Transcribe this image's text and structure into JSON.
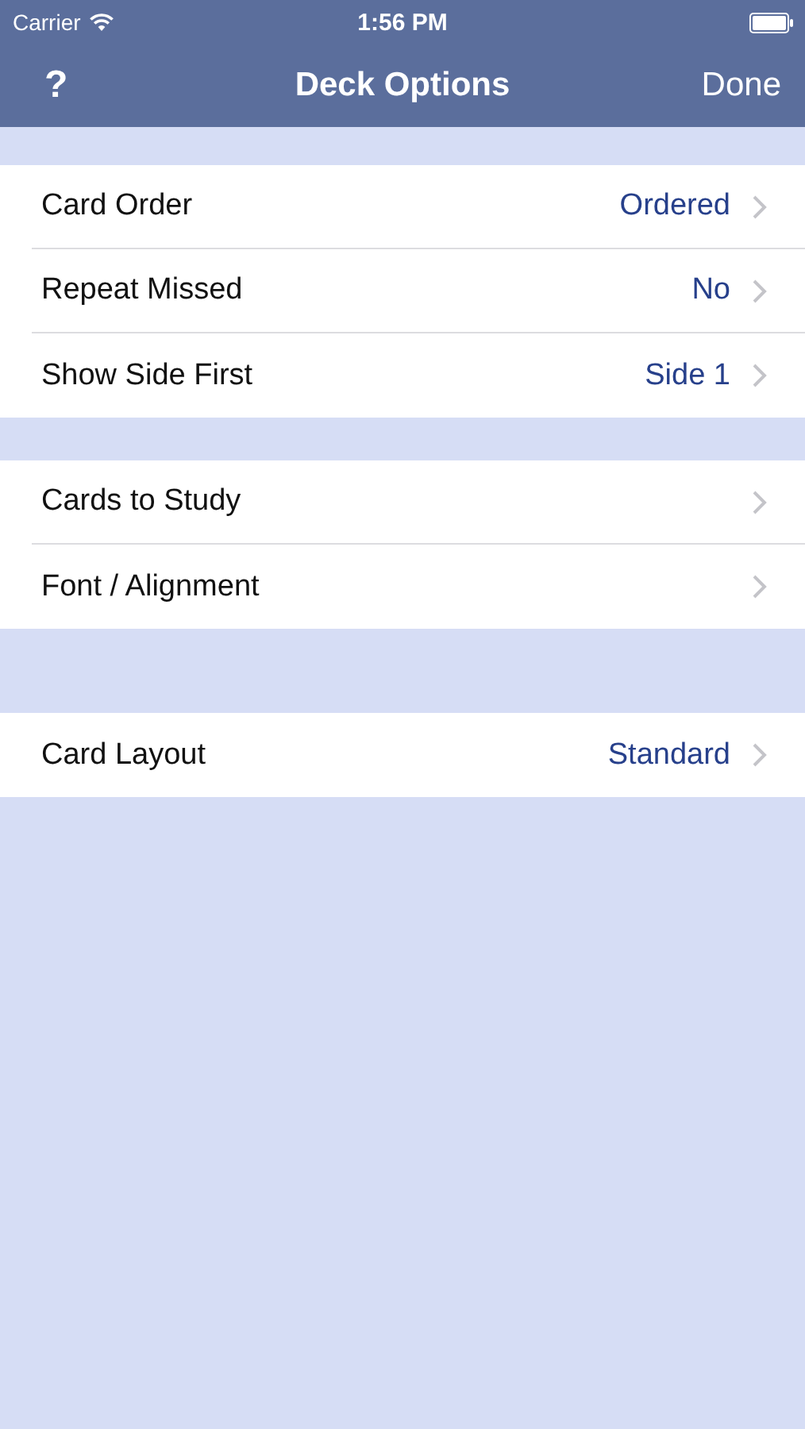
{
  "status_bar": {
    "carrier": "Carrier",
    "time": "1:56 PM"
  },
  "nav_bar": {
    "left": "?",
    "title": "Deck Options",
    "right": "Done"
  },
  "sections": [
    {
      "rows": [
        {
          "label": "Card Order",
          "value": "Ordered"
        },
        {
          "label": "Repeat Missed",
          "value": "No"
        },
        {
          "label": "Show Side First",
          "value": "Side 1"
        }
      ]
    },
    {
      "rows": [
        {
          "label": "Cards to Study"
        },
        {
          "label": "Font / Alignment"
        }
      ]
    },
    {
      "rows": [
        {
          "label": "Card Layout",
          "value": "Standard"
        }
      ]
    }
  ]
}
